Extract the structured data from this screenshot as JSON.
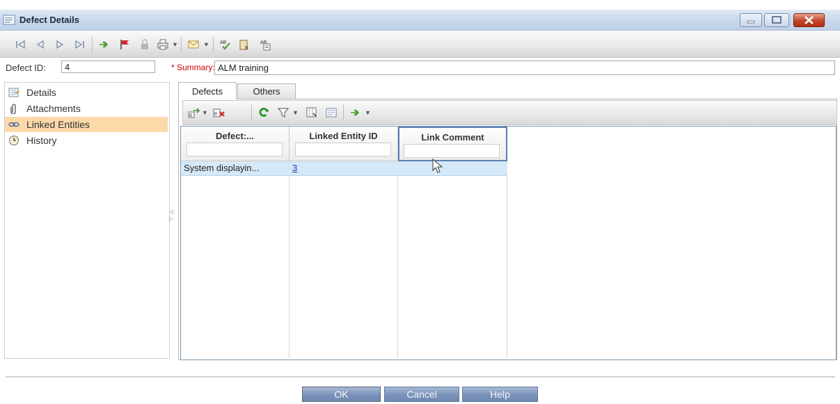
{
  "window": {
    "title": "Defect Details"
  },
  "toolbar": {
    "icons": [
      "first-record-icon",
      "previous-record-icon",
      "next-record-icon",
      "last-record-icon",
      "send-icon",
      "flag-icon",
      "lock-icon",
      "print-icon",
      "mail-icon",
      "spell-check-icon",
      "thesaurus-icon",
      "spelling-options-icon"
    ]
  },
  "form": {
    "defect_id_label": "Defect ID:",
    "defect_id_value": "4",
    "summary_label": "* Summary:",
    "summary_value": "ALM training"
  },
  "sidebar": {
    "items": [
      {
        "label": "Details",
        "icon": "details-icon",
        "selected": false
      },
      {
        "label": "Attachments",
        "icon": "attachment-icon",
        "selected": false
      },
      {
        "label": "Linked Entities",
        "icon": "link-icon",
        "selected": true
      },
      {
        "label": "History",
        "icon": "history-icon",
        "selected": false
      }
    ]
  },
  "tabs": [
    {
      "label": "Defects",
      "active": true
    },
    {
      "label": "Others",
      "active": false
    }
  ],
  "grid": {
    "columns": [
      "Defect:...",
      "Linked Entity ID",
      "Link Comment"
    ],
    "rows": [
      {
        "defect": "System displayin...",
        "linked_entity_id": "3",
        "link_comment": ""
      }
    ]
  },
  "buttons": {
    "ok": "OK",
    "cancel": "Cancel",
    "help": "Help"
  },
  "colors": {
    "selection": "#fbd9a9",
    "row_highlight": "#d6e9f8",
    "link": "#1a3fb5",
    "required_label": "#cc0000",
    "button_blue": "#7a92b9"
  }
}
